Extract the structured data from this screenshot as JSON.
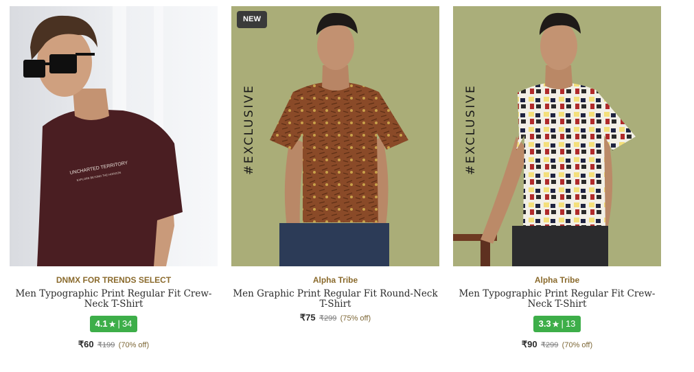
{
  "products": [
    {
      "brand": "DNMX FOR TRENDS SELECT",
      "name": "Men Typographic Print Regular Fit Crew-Neck T-Shirt",
      "tag": "",
      "rating": "4.1",
      "rating_star": "★",
      "rating_sep": "|",
      "rating_count": "34",
      "price": "₹60",
      "mrp": "₹199",
      "discount": "(70% off)"
    },
    {
      "brand": "Alpha Tribe",
      "name": "Men Graphic Print Regular Fit Round-Neck T-Shirt",
      "tag": "NEW",
      "exclusive": "#EXCLUSIVE",
      "price": "₹75",
      "mrp": "₹299",
      "discount": "(75% off)"
    },
    {
      "brand": "Alpha Tribe",
      "name": "Men Typographic Print Regular Fit Crew-Neck T-Shirt",
      "exclusive": "#EXCLUSIVE",
      "rating": "3.3",
      "rating_star": "★",
      "rating_sep": "|",
      "rating_count": "13",
      "price": "₹90",
      "mrp": "₹299",
      "discount": "(70% off)"
    }
  ],
  "colors": {
    "brand_text": "#8a6a2c",
    "rating_badge": "#3dae49",
    "new_badge": "#3a3a3a",
    "olive_background": "#a9ad78"
  }
}
